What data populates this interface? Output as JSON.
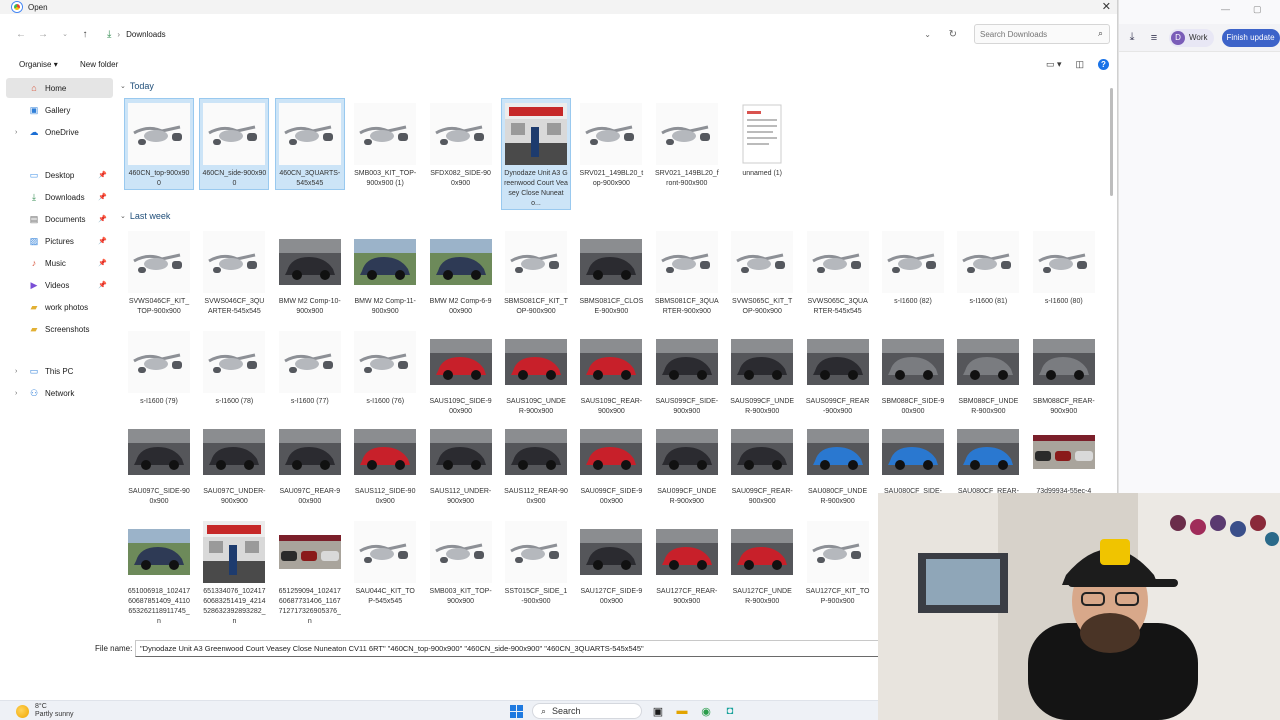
{
  "dialog": {
    "title": "Open",
    "close_icon": "close-icon",
    "breadcrumb": "Downloads",
    "search_placeholder": "Search Downloads",
    "organise_label": "Organise",
    "new_folder_label": "New folder"
  },
  "sidebar": {
    "items": [
      {
        "label": "Home",
        "icon": "home-icon",
        "pinned": false
      },
      {
        "label": "Gallery",
        "icon": "gallery-icon",
        "pinned": false
      },
      {
        "label": "OneDrive",
        "icon": "cloud-icon",
        "pinned": false
      },
      {
        "label": "Desktop",
        "icon": "desktop-icon",
        "pinned": true
      },
      {
        "label": "Downloads",
        "icon": "download-icon",
        "pinned": true
      },
      {
        "label": "Documents",
        "icon": "documents-icon",
        "pinned": true
      },
      {
        "label": "Pictures",
        "icon": "pictures-icon",
        "pinned": true
      },
      {
        "label": "Music",
        "icon": "music-icon",
        "pinned": true
      },
      {
        "label": "Videos",
        "icon": "videos-icon",
        "pinned": true
      },
      {
        "label": "work photos",
        "icon": "folder-icon",
        "pinned": false
      },
      {
        "label": "Screenshots",
        "icon": "folder-icon",
        "pinned": false
      },
      {
        "label": "This PC",
        "icon": "pc-icon",
        "pinned": false
      },
      {
        "label": "Network",
        "icon": "network-icon",
        "pinned": false
      }
    ]
  },
  "groups": [
    {
      "label": "Today",
      "files": [
        {
          "name": "460CN_top-900x900",
          "kind": "exhaust",
          "selected": true
        },
        {
          "name": "460CN_side-900x900",
          "kind": "exhaust",
          "selected": true
        },
        {
          "name": "460CN_3QUARTS-545x545",
          "kind": "exhaust",
          "selected": true
        },
        {
          "name": "SMB003_KIT_TOP-900x900 (1)",
          "kind": "exhaust",
          "selected": false
        },
        {
          "name": "SFDX082_SIDE-900x900",
          "kind": "exhaust",
          "selected": false
        },
        {
          "name": "Dynodaze Unit A3 Greenwood Court Veasey Close Nuneato...",
          "kind": "poster",
          "selected": true
        },
        {
          "name": "SRV021_149BL20_top-900x900",
          "kind": "exhaust",
          "selected": false
        },
        {
          "name": "SRV021_149BL20_front-900x900",
          "kind": "exhaust",
          "selected": false
        },
        {
          "name": "unnamed (1)",
          "kind": "document",
          "selected": false
        }
      ]
    },
    {
      "label": "Last week",
      "files": [
        {
          "name": "SVWS046CF_KIT_TOP-900x900",
          "kind": "exhaust"
        },
        {
          "name": "SVWS046CF_3QUARTER-545x545",
          "kind": "exhaust"
        },
        {
          "name": "BMW M2 Comp-10-900x900",
          "kind": "car-dark"
        },
        {
          "name": "BMW M2 Comp-11-900x900",
          "kind": "car-outdoor"
        },
        {
          "name": "BMW M2 Comp-6-900x900",
          "kind": "car-outdoor"
        },
        {
          "name": "SBMS081CF_KIT_TOP-900x900",
          "kind": "exhaust"
        },
        {
          "name": "SBMS081CF_CLOSE-900x900",
          "kind": "car-dark"
        },
        {
          "name": "SBMS081CF_3QUARTER-900x900",
          "kind": "exhaust"
        },
        {
          "name": "SVWS065C_KIT_TOP-900x900",
          "kind": "exhaust"
        },
        {
          "name": "SVWS065C_3QUARTER-545x545",
          "kind": "exhaust"
        },
        {
          "name": "s-I1600 (82)",
          "kind": "exhaust"
        },
        {
          "name": "s-I1600 (81)",
          "kind": "exhaust"
        },
        {
          "name": "s-I1600 (80)",
          "kind": "exhaust"
        },
        {
          "name": "s-I1600 (79)",
          "kind": "exhaust"
        },
        {
          "name": "s-I1600 (78)",
          "kind": "exhaust"
        },
        {
          "name": "s-I1600 (77)",
          "kind": "exhaust"
        },
        {
          "name": "s-I1600 (76)",
          "kind": "exhaust"
        },
        {
          "name": "SAUS109C_SIDE-900x900",
          "kind": "car-red"
        },
        {
          "name": "SAUS109C_UNDER-900x900",
          "kind": "car-red"
        },
        {
          "name": "SAUS109C_REAR-900x900",
          "kind": "car-red"
        },
        {
          "name": "SAUS099CF_SIDE-900x900",
          "kind": "car-dark"
        },
        {
          "name": "SAUS099CF_UNDER-900x900",
          "kind": "car-dark"
        },
        {
          "name": "SAUS099CF_REAR-900x900",
          "kind": "car-dark"
        },
        {
          "name": "SBM088CF_SIDE-900x900",
          "kind": "car-grey"
        },
        {
          "name": "SBM088CF_UNDER-900x900",
          "kind": "car-grey"
        },
        {
          "name": "SBM088CF_REAR-900x900",
          "kind": "car-grey"
        },
        {
          "name": "SAU097C_SIDE-900x900",
          "kind": "car-dark"
        },
        {
          "name": "SAU097C_UNDER-900x900",
          "kind": "car-dark"
        },
        {
          "name": "SAU097C_REAR-900x900",
          "kind": "car-dark"
        },
        {
          "name": "SAUS112_SIDE-900x900",
          "kind": "car-red"
        },
        {
          "name": "SAUS112_UNDER-900x900",
          "kind": "car-dark"
        },
        {
          "name": "SAUS112_REAR-900x900",
          "kind": "car-dark"
        },
        {
          "name": "SAU099CF_SIDE-900x900",
          "kind": "car-red"
        },
        {
          "name": "SAU099CF_UNDER-900x900",
          "kind": "car-dark"
        },
        {
          "name": "SAU099CF_REAR-900x900",
          "kind": "car-dark"
        },
        {
          "name": "SAU080CF_UNDER-900x900",
          "kind": "car-blue"
        },
        {
          "name": "SAU080CF_SIDE-",
          "kind": "car-blue"
        },
        {
          "name": "SAU080CF_REAR-",
          "kind": "car-blue"
        },
        {
          "name": "73d99934-55ec-4",
          "kind": "showroom"
        },
        {
          "name": "651006918_10241760687851409_4110653262118911745_n",
          "kind": "car-outdoor"
        },
        {
          "name": "651334076_10241760683251419_4214528632392893282_n",
          "kind": "poster"
        },
        {
          "name": "651259094_10241760687731406_1167712717326905376_n",
          "kind": "showroom"
        },
        {
          "name": "SAU044C_KIT_TOP-545x545",
          "kind": "exhaust"
        },
        {
          "name": "SMB003_KIT_TOP-900x900",
          "kind": "exhaust"
        },
        {
          "name": "SST015CF_SIDE_1-900x900",
          "kind": "exhaust"
        },
        {
          "name": "SAU127CF_SIDE-900x900",
          "kind": "car-dark"
        },
        {
          "name": "SAU127CF_REAR-900x900",
          "kind": "car-red"
        },
        {
          "name": "SAU127CF_UNDER-900x900",
          "kind": "car-red"
        },
        {
          "name": "SAU127CF_KIT_TOP-900x900",
          "kind": "exhaust"
        }
      ]
    }
  ],
  "filename": {
    "label": "File name:",
    "value": "\"Dynodaze Unit A3 Greenwood Court Veasey Close Nuneaton CV11 6RT\" \"460CN_top-900x900\" \"460CN_side-900x900\" \"460CN_3QUARTS-545x545\""
  },
  "browser": {
    "profile_initial": "D",
    "profile_label": "Work",
    "finish_update_label": "Finish update"
  },
  "taskbar": {
    "temperature": "8°C",
    "weather": "Partly sunny",
    "search_label": "Search"
  },
  "colors": {
    "selection_bg": "#cce4f7",
    "selection_border": "#99c9ef",
    "accent": "#1a73e8"
  }
}
